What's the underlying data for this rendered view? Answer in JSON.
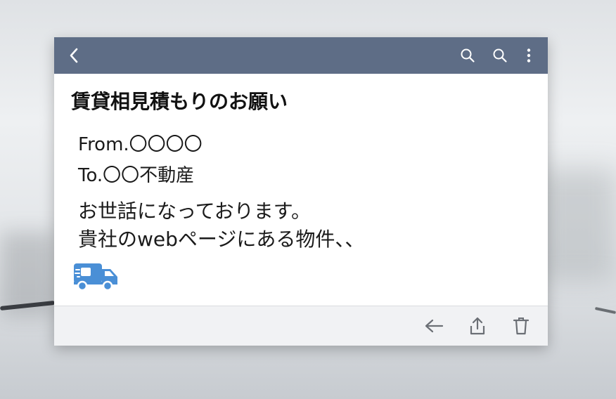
{
  "window": {
    "subject": "賃貸相見積もりのお願い",
    "from": "From.〇〇〇〇",
    "to": "To.〇〇不動産",
    "body_lines": [
      "お世話になっております。",
      "貴社のwebページにある物件、、"
    ]
  },
  "icons": {
    "title_bar": [
      "back-chevron-icon",
      "search-icon",
      "search-icon",
      "more-vertical-icon"
    ],
    "bottom_bar": [
      "arrow-left-icon",
      "share-icon",
      "trash-icon"
    ],
    "inline": "delivery-truck-icon"
  },
  "colors": {
    "title_bar": "#5e6d86",
    "bottom_bar": "#f1f2f4",
    "truck": "#4a8fd6"
  }
}
